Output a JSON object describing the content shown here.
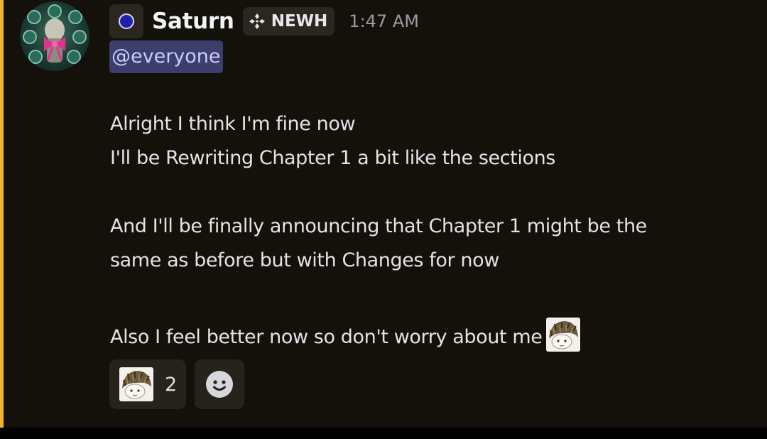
{
  "message": {
    "author": {
      "name": "Saturn",
      "role_dot_color": "#1e22a8",
      "tag": "NEWH",
      "tag_icon": "diamond-cross-icon"
    },
    "timestamp": "1:47 AM",
    "mention": "@everyone",
    "lines": [
      "Alright I think I'm fine now",
      "I'll be Rewriting Chapter 1 a bit like the sections",
      "And I'll be finally announcing that Chapter 1 might be the",
      "same as before but with Changes for now",
      "Also I feel better now so don't worry about me"
    ],
    "inline_emoji": "hedgehog-emoji",
    "highlight_color": "#f0b232"
  },
  "reactions": [
    {
      "emoji": "hedgehog-emoji",
      "count": "2"
    }
  ],
  "add_reaction_icon": "smiley-icon"
}
